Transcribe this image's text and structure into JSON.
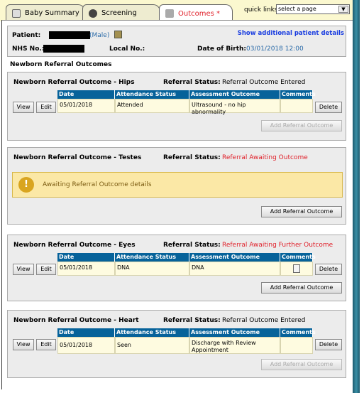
{
  "tabs": [
    {
      "label": "Baby Summary",
      "icon": "document-icon"
    },
    {
      "label": "Screening",
      "icon": "heart-icon"
    },
    {
      "label": "Outcomes *",
      "icon": "dice-icon",
      "active": true
    }
  ],
  "quick_links": {
    "label": "quick links:",
    "value": "select a page"
  },
  "patient": {
    "patient_label": "Patient:",
    "sex": "(Male)",
    "nhs_label": "NHS No.:",
    "local_label": "Local No.:",
    "dob_label": "Date of Birth:",
    "dob": "03/01/2018 12:00",
    "details_link": "Show additional patient details"
  },
  "section_title": "Newborn Referral Outcomes",
  "columns": [
    "Date",
    "Attendance Status",
    "Assessment Outcome",
    "Comments"
  ],
  "labels": {
    "status": "Referral Status:",
    "view": "View",
    "edit": "Edit",
    "delete": "Delete",
    "add": "Add Referral Outcome"
  },
  "outcomes": [
    {
      "title": "Newborn Referral Outcome - Hips",
      "status": "Referral Outcome Entered",
      "status_color": "#000000",
      "row": {
        "date": "05/01/2018",
        "attendance": "Attended",
        "assessment": "Ultrasound - no hip abnormality",
        "comments": ""
      },
      "add_disabled": true
    },
    {
      "title": "Newborn Referral Outcome - Testes",
      "status": "Referral Awaiting Outcome",
      "status_color": "#e0202a",
      "warning": "Awaiting Referral Outcome details",
      "add_disabled": false
    },
    {
      "title": "Newborn Referral Outcome - Eyes",
      "status": "Referral Awaiting Further Outcome",
      "status_color": "#e0202a",
      "row": {
        "date": "05/01/2018",
        "attendance": "DNA",
        "assessment": "DNA",
        "comments": "note-icon"
      },
      "add_disabled": false
    },
    {
      "title": "Newborn Referral Outcome - Heart",
      "status": "Referral Outcome Entered",
      "status_color": "#000000",
      "row": {
        "date": "05/01/2018",
        "attendance": "Seen",
        "assessment": "Discharge with Review Appointment",
        "comments": ""
      },
      "add_disabled": true
    }
  ]
}
